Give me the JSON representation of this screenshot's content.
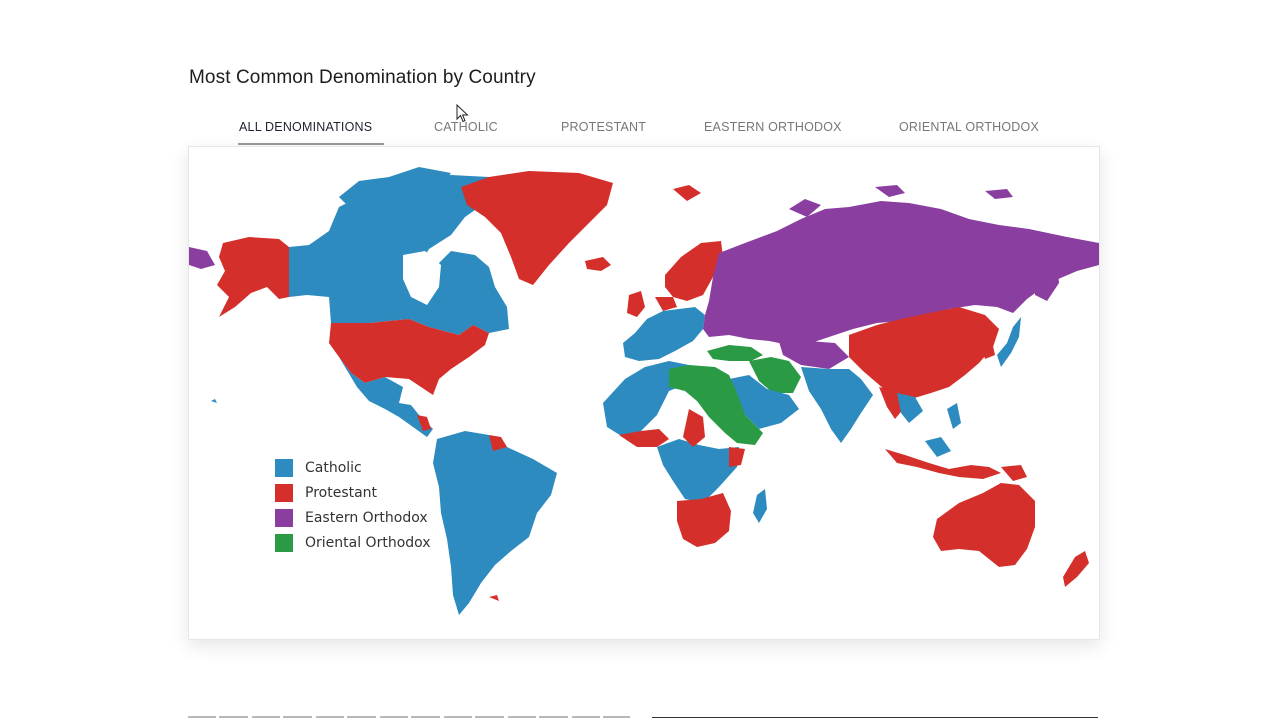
{
  "title": "Most Common Denomination by Country",
  "tabs": [
    {
      "label": "ALL DENOMINATIONS",
      "active": true
    },
    {
      "label": "CATHOLIC",
      "active": false
    },
    {
      "label": "PROTESTANT",
      "active": false
    },
    {
      "label": "EASTERN ORTHODOX",
      "active": false
    },
    {
      "label": "ORIENTAL ORTHODOX",
      "active": false
    }
  ],
  "legend": [
    {
      "label": "Catholic",
      "color": "#2e8bc0"
    },
    {
      "label": "Protestant",
      "color": "#d42f2a"
    },
    {
      "label": "Eastern Orthodox",
      "color": "#8a3fa0"
    },
    {
      "label": "Oriental Orthodox",
      "color": "#2a9a45"
    }
  ],
  "colors": {
    "catholic": "#2e8bc0",
    "protestant": "#d42f2a",
    "eastern_orthodox": "#8a3fa0",
    "oriental_orthodox": "#2a9a45"
  }
}
